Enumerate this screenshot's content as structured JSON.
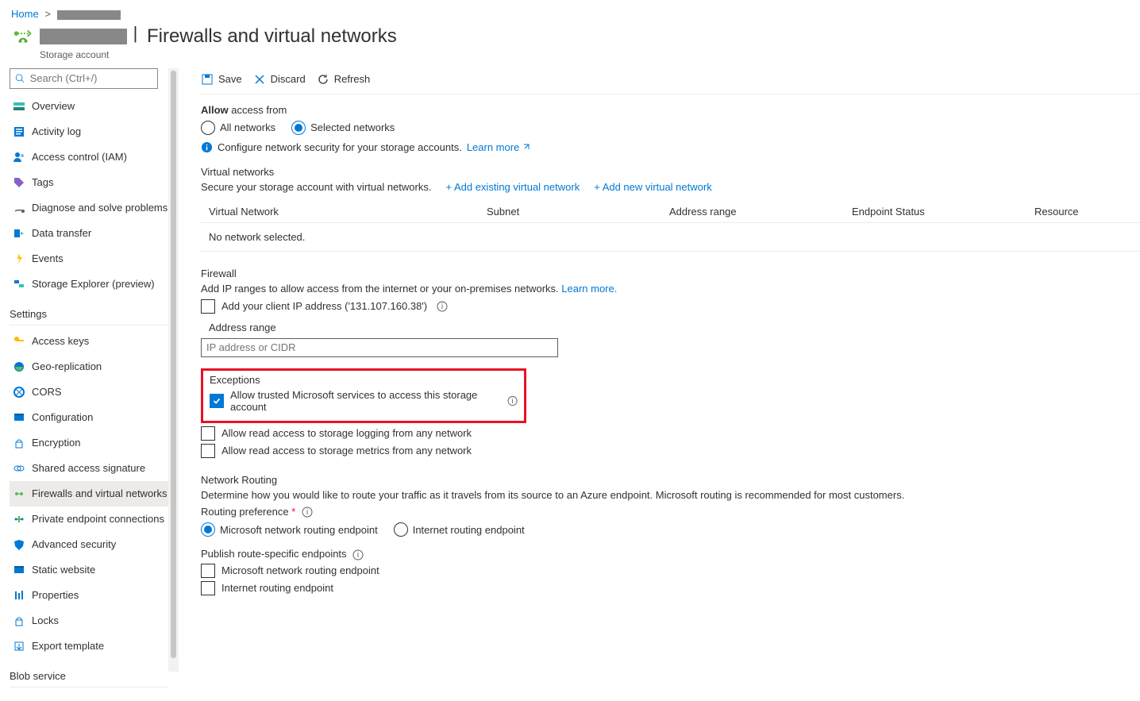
{
  "breadcrumb": {
    "home": "Home"
  },
  "header": {
    "title_suffix": "Firewalls and virtual networks",
    "subtitle": "Storage account"
  },
  "search": {
    "placeholder": "Search (Ctrl+/)"
  },
  "sidebar": {
    "items": [
      {
        "label": "Overview"
      },
      {
        "label": "Activity log"
      },
      {
        "label": "Access control (IAM)"
      },
      {
        "label": "Tags"
      },
      {
        "label": "Diagnose and solve problems"
      },
      {
        "label": "Data transfer"
      },
      {
        "label": "Events"
      },
      {
        "label": "Storage Explorer (preview)"
      }
    ],
    "settings_label": "Settings",
    "settings": [
      {
        "label": "Access keys"
      },
      {
        "label": "Geo-replication"
      },
      {
        "label": "CORS"
      },
      {
        "label": "Configuration"
      },
      {
        "label": "Encryption"
      },
      {
        "label": "Shared access signature"
      },
      {
        "label": "Firewalls and virtual networks"
      },
      {
        "label": "Private endpoint connections"
      },
      {
        "label": "Advanced security"
      },
      {
        "label": "Static website"
      },
      {
        "label": "Properties"
      },
      {
        "label": "Locks"
      },
      {
        "label": "Export template"
      }
    ],
    "blob_label": "Blob service"
  },
  "toolbar": {
    "save": "Save",
    "discard": "Discard",
    "refresh": "Refresh"
  },
  "access": {
    "label_prefix": "Allow",
    "label_rest": " access from",
    "all": "All networks",
    "selected": "Selected networks",
    "info_text": "Configure network security for your storage accounts. ",
    "learn_more": "Learn more"
  },
  "vnet": {
    "heading": "Virtual networks",
    "desc": "Secure your storage account with virtual networks.",
    "add_existing": "+ Add existing virtual network",
    "add_new": "+ Add new virtual network",
    "cols": {
      "c1": "Virtual Network",
      "c2": "Subnet",
      "c3": "Address range",
      "c4": "Endpoint Status",
      "c5": "Resource"
    },
    "empty": "No network selected."
  },
  "firewall": {
    "heading": "Firewall",
    "desc": "Add IP ranges to allow access from the internet or your on-premises networks. ",
    "learn_more": "Learn more.",
    "client_ip": "Add your client IP address ('131.107.160.38')",
    "range_col": "Address range",
    "placeholder": "IP address or CIDR"
  },
  "exceptions": {
    "heading": "Exceptions",
    "trusted": "Allow trusted Microsoft services to access this storage account",
    "logging": "Allow read access to storage logging from any network",
    "metrics": "Allow read access to storage metrics from any network"
  },
  "routing": {
    "heading": "Network Routing",
    "desc": "Determine how you would like to route your traffic as it travels from its source to an Azure endpoint. Microsoft routing is recommended for most customers.",
    "pref_label": "Routing preference ",
    "ms_route": "Microsoft network routing endpoint",
    "inet_route": "Internet routing endpoint",
    "publish_label": "Publish route-specific endpoints",
    "publish_ms": "Microsoft network routing endpoint",
    "publish_inet": "Internet routing endpoint"
  }
}
